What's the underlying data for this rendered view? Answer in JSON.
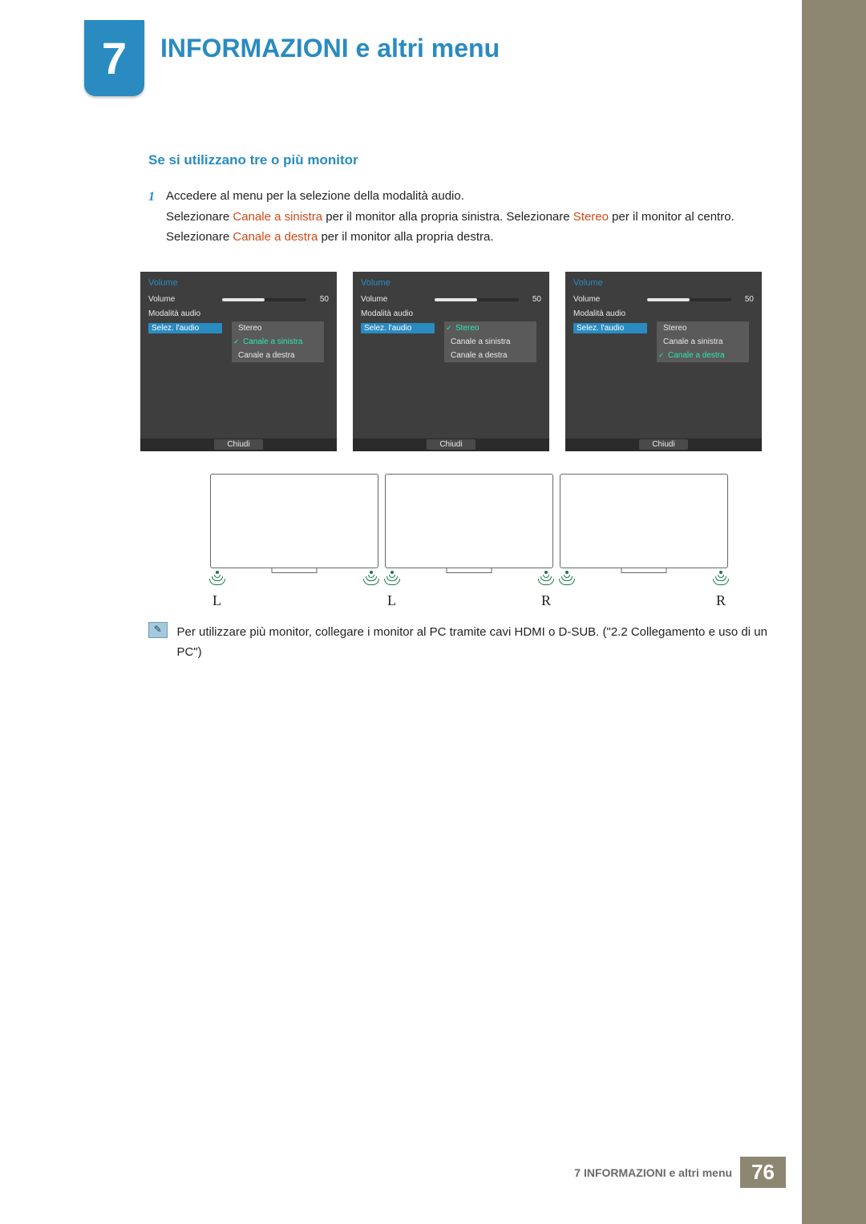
{
  "chapter": {
    "number": "7",
    "title": "INFORMAZIONI e altri menu"
  },
  "section_title": "Se si utilizzano tre o più monitor",
  "step": {
    "num": "1",
    "line1": "Accedere al menu per la selezione della modalità audio.",
    "line2a": "Selezionare ",
    "em1": "Canale a sinistra",
    "line2b": " per il monitor alla propria sinistra. Selezionare ",
    "em2": "Stereo",
    "line2c": " per il monitor al centro. Selezionare ",
    "em3": "Canale a destra",
    "line2d": " per il monitor alla propria destra."
  },
  "osd": {
    "title": "Volume",
    "row_volume": "Volume",
    "row_mode": "Modalità audio",
    "row_select": "Selez. l'audio",
    "value": "50",
    "opt_stereo": "Stereo",
    "opt_left": "Canale a sinistra",
    "opt_right": "Canale a destra",
    "close": "Chiudi"
  },
  "speakers": {
    "L": "L",
    "R": "R"
  },
  "note": "Per utilizzare più monitor, collegare i monitor al PC tramite cavi HDMI o D-SUB. (\"2.2 Collegamento e uso di un PC\")",
  "footer": {
    "label": "7 INFORMAZIONI e altri menu",
    "page": "76"
  }
}
